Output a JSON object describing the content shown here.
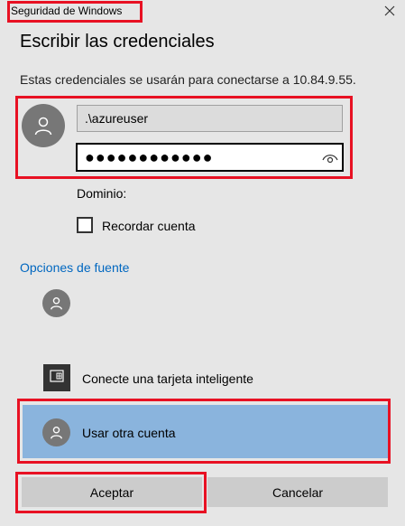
{
  "window": {
    "title": "Seguridad de Windows",
    "close_glyph": "✕"
  },
  "dialog": {
    "heading": "Escribir las credenciales",
    "description": "Estas credenciales se usarán para conectarse a 10.84.9.55."
  },
  "credentials": {
    "username_value": ".\\azureuser",
    "password_mask": "●●●●●●●●●●●●",
    "domain_label": "Dominio:",
    "remember_label": "Recordar cuenta",
    "remember_checked": false
  },
  "options": {
    "link_label": "Opciones de fuente",
    "items": [
      {
        "label": "",
        "icon": "user-icon"
      },
      {
        "label": "Conecte una tarjeta inteligente",
        "icon": "smartcard-icon"
      },
      {
        "label": "Usar otra cuenta",
        "icon": "user-icon",
        "selected": true
      }
    ]
  },
  "buttons": {
    "ok_label": "Aceptar",
    "cancel_label": "Cancelar"
  },
  "colors": {
    "background": "#e6e6e6",
    "accent_link": "#0067c0",
    "selected_row": "#8ab4dd",
    "highlight": "#e81123",
    "button": "#cccccc"
  }
}
